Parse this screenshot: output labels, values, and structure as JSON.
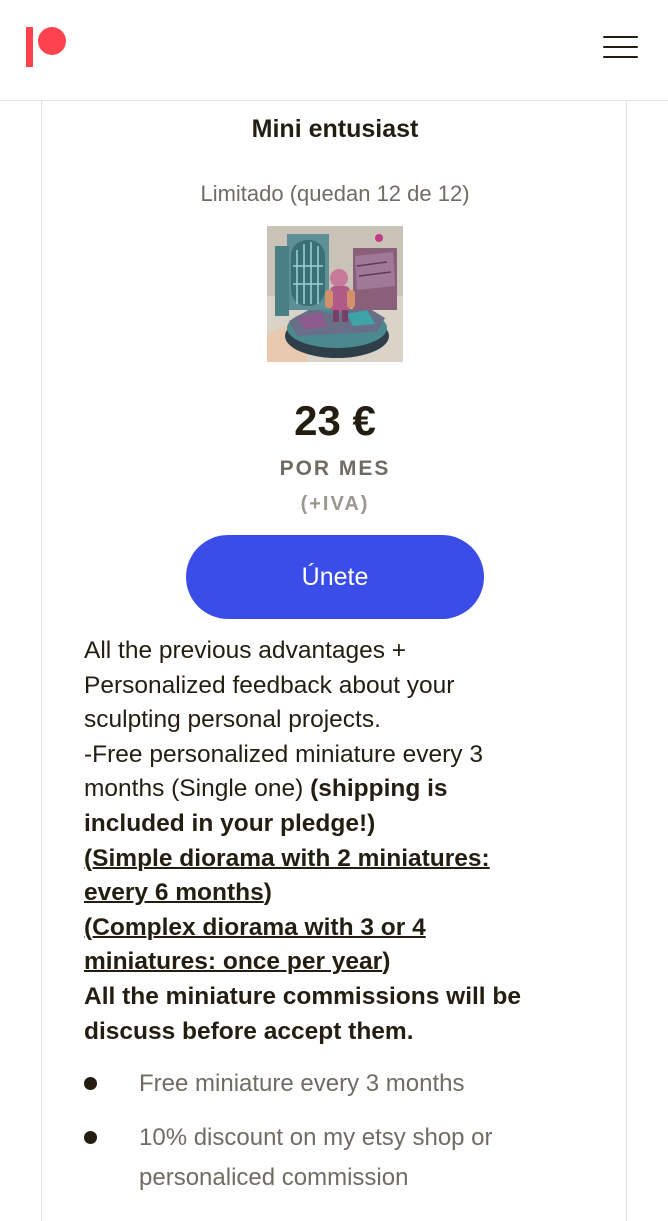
{
  "header": {
    "logo_label": "Patreon",
    "menu_icon": "hamburger-menu-icon"
  },
  "tier": {
    "title": "Mini entusiast",
    "limit_text": "Limitado (quedan 12 de 12)",
    "image_alt": "Painted miniature diorama",
    "price": "23 €",
    "period": "POR MES",
    "tax_note": "(+IVA)",
    "join_label": "Únete",
    "description_lines": {
      "l1": "All the previous advantages +",
      "l2": "Personalized feedback about your",
      "l3": "sculpting personal projects.",
      "l4": "-Free personalized miniature every 3",
      "l5a": "months (Single one) ",
      "l5b": "(shipping is",
      "l6": "included in your pledge!)",
      "l7": "(Simple diorama with 2 miniatures:",
      "l8a": "every 6 months",
      "l8b": ")",
      "l9": "(Complex diorama with 3 or 4",
      "l10a": "miniatures: once per year",
      "l10b": ")",
      "l11": "All the miniature commissions will be",
      "l12": "discuss before accept them."
    },
    "benefits": [
      "Free miniature every 3 months",
      "10% discount on my etsy shop or personaliced commission"
    ]
  },
  "colors": {
    "brand": "#ff424d",
    "button": "#3b4de8",
    "text": "#241e12",
    "muted": "#706c64"
  }
}
